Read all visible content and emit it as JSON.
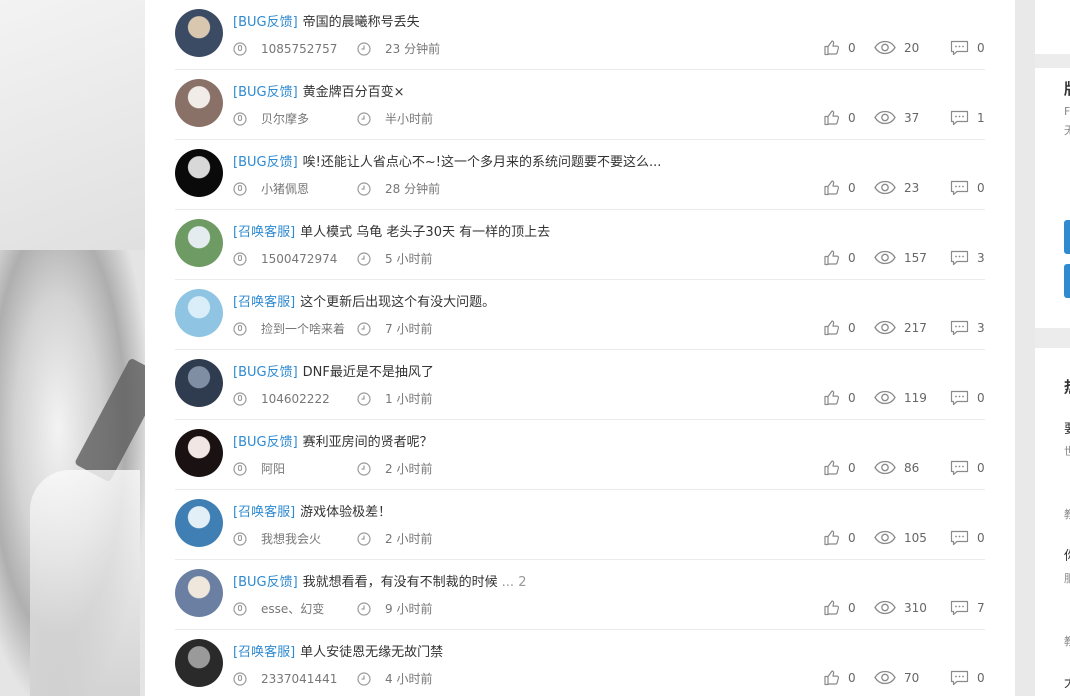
{
  "posts": [
    {
      "tag": "[BUG反馈]",
      "title": "帝国的晨曦称号丢失",
      "pages": "",
      "author": "1085752757",
      "time": "23 分钟前",
      "likes": "0",
      "views": "20",
      "comments": "0",
      "avatar_colors": [
        "#3a4b63",
        "#d9c7b0"
      ]
    },
    {
      "tag": "[BUG反馈]",
      "title": "黄金牌百分百变×",
      "pages": "",
      "author": "贝尔摩多",
      "time": "半小时前",
      "likes": "0",
      "views": "37",
      "comments": "1",
      "avatar_colors": [
        "#8a7168",
        "#f2ece8"
      ]
    },
    {
      "tag": "[BUG反馈]",
      "title": "唉!还能让人省点心不~!这一个多月来的系统问题要不要这么...",
      "pages": "",
      "author": "小猪佩恩",
      "time": "28 分钟前",
      "likes": "0",
      "views": "23",
      "comments": "0",
      "avatar_colors": [
        "#0a0a0a",
        "#d8d8d8"
      ]
    },
    {
      "tag": "[召唤客服]",
      "title": "单人模式 乌龟 老头子30天 有一样的顶上去",
      "pages": "",
      "author": "1500472974",
      "time": "5 小时前",
      "likes": "0",
      "views": "157",
      "comments": "3",
      "avatar_colors": [
        "#6e9a63",
        "#e4ecef"
      ]
    },
    {
      "tag": "[召唤客服]",
      "title": "这个更新后出现这个有没大问题。",
      "pages": "",
      "author": "捡到一个啥来着",
      "time": "7 小时前",
      "likes": "0",
      "views": "217",
      "comments": "3",
      "avatar_colors": [
        "#8fc4e3",
        "#d9eef8"
      ]
    },
    {
      "tag": "[BUG反馈]",
      "title": "DNF最近是不是抽风了",
      "pages": "",
      "author": "104602222",
      "time": "1 小时前",
      "likes": "0",
      "views": "119",
      "comments": "0",
      "avatar_colors": [
        "#2f3b4e",
        "#7f8ea3"
      ]
    },
    {
      "tag": "[BUG反馈]",
      "title": "赛利亚房间的贤者呢？",
      "pages": "",
      "author": "阿阳",
      "time": "2 小时前",
      "likes": "0",
      "views": "86",
      "comments": "0",
      "avatar_colors": [
        "#1a1212",
        "#f1e6e3"
      ]
    },
    {
      "tag": "[召唤客服]",
      "title": "游戏体验极差！",
      "pages": "",
      "author": "我想我会火",
      "time": "2 小时前",
      "likes": "0",
      "views": "105",
      "comments": "0",
      "avatar_colors": [
        "#3f7fb3",
        "#e3eff6"
      ]
    },
    {
      "tag": "[BUG反馈]",
      "title": "我就想看看，有没有不制裁的时候",
      "pages": "... 2",
      "author": "esse、幻变",
      "time": "9 小时前",
      "likes": "0",
      "views": "310",
      "comments": "7",
      "avatar_colors": [
        "#6b7fa3",
        "#efe7dc"
      ]
    },
    {
      "tag": "[召唤客服]",
      "title": "单人安徒恩无缘无故门禁",
      "pages": "",
      "author": "2337041441",
      "time": "4 小时前",
      "likes": "0",
      "views": "70",
      "comments": "0",
      "avatar_colors": [
        "#2a2a2a",
        "#9a9a9a"
      ]
    }
  ],
  "colors": {
    "tag": "#2f8ad0",
    "icon": "#9a9a9a",
    "accent": "#2f8ad0"
  },
  "icons": {
    "author": "user-icon",
    "time": "clock-icon",
    "like": "thumbs-up-icon",
    "view": "eye-icon",
    "comment": "comment-icon"
  },
  "sidebar": {
    "fragments": [
      "版",
      "F",
      "无",
      "热",
      "要",
      "世",
      "教",
      "你",
      "服",
      "教",
      "大"
    ]
  }
}
